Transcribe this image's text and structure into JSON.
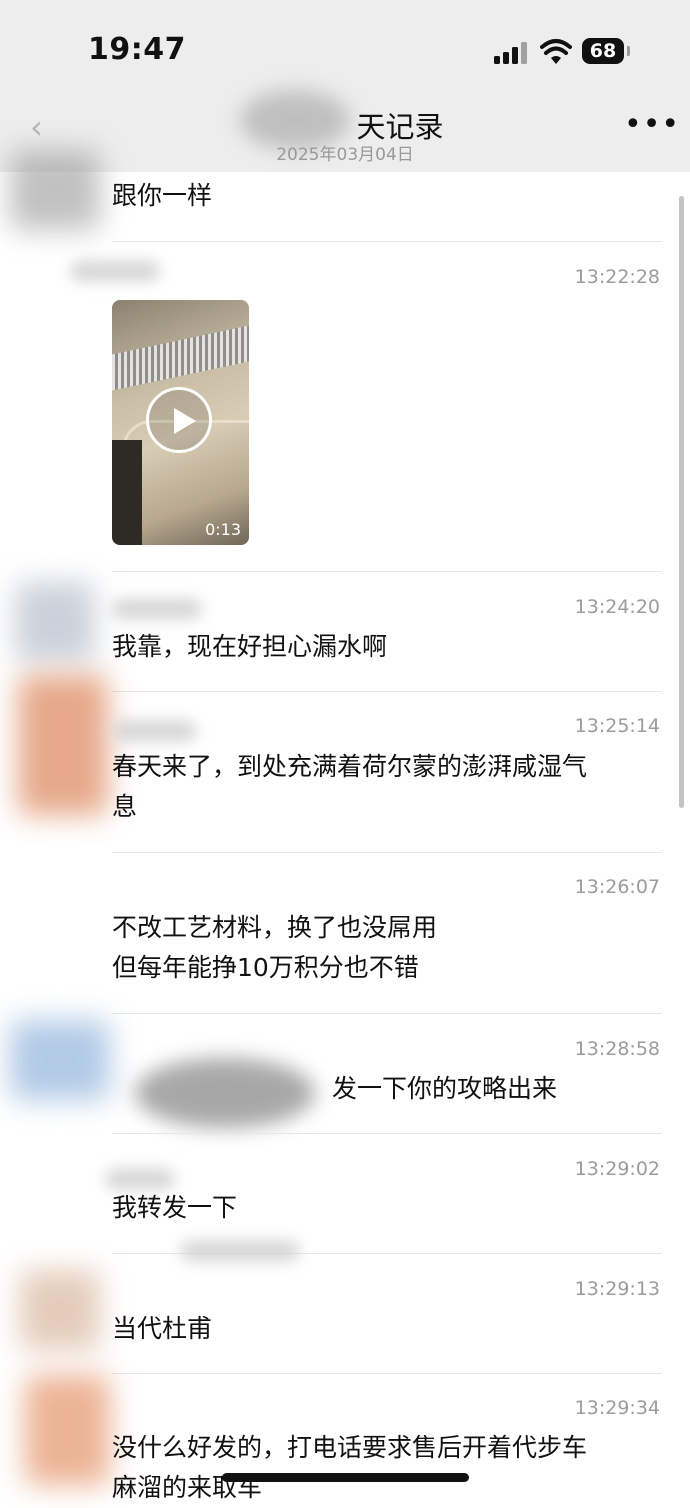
{
  "status_bar": {
    "time": "19:47",
    "battery": "68"
  },
  "nav": {
    "title": "天记录",
    "subtitle": "2025年03月04日"
  },
  "messages": [
    {
      "lines": [
        "跟你一样"
      ]
    },
    {
      "time": "13:22:28",
      "video_duration": "0:13"
    },
    {
      "time": "13:24:20",
      "lines": [
        "我靠，现在好担心漏水啊"
      ]
    },
    {
      "time": "13:25:14",
      "lines": [
        "春天来了，到处充满着荷尔蒙的澎湃咸湿气",
        "息"
      ]
    },
    {
      "time": "13:26:07",
      "lines": [
        "不改工艺材料，换了也没屌用",
        "但每年能挣10万积分也不错"
      ]
    },
    {
      "time": "13:28:58",
      "lines": [
        "发一下你的攻略出来"
      ]
    },
    {
      "time": "13:29:02",
      "lines": [
        "我转发一下"
      ]
    },
    {
      "time": "13:29:13",
      "lines": [
        "当代杜甫"
      ]
    },
    {
      "time": "13:29:34",
      "lines": [
        "没什么好发的，打电话要求售后开着代步车",
        "麻溜的来取车"
      ]
    }
  ],
  "icons": {
    "back": "chevron-left-icon",
    "more": "more-dots-icon",
    "play": "play-icon",
    "signal": "cellular-signal-icon",
    "wifi": "wifi-icon",
    "battery": "battery-icon"
  },
  "colors": {
    "nav_background": "#ededed",
    "timestamp": "#9c9c9c",
    "divider": "#e6e6e6"
  }
}
